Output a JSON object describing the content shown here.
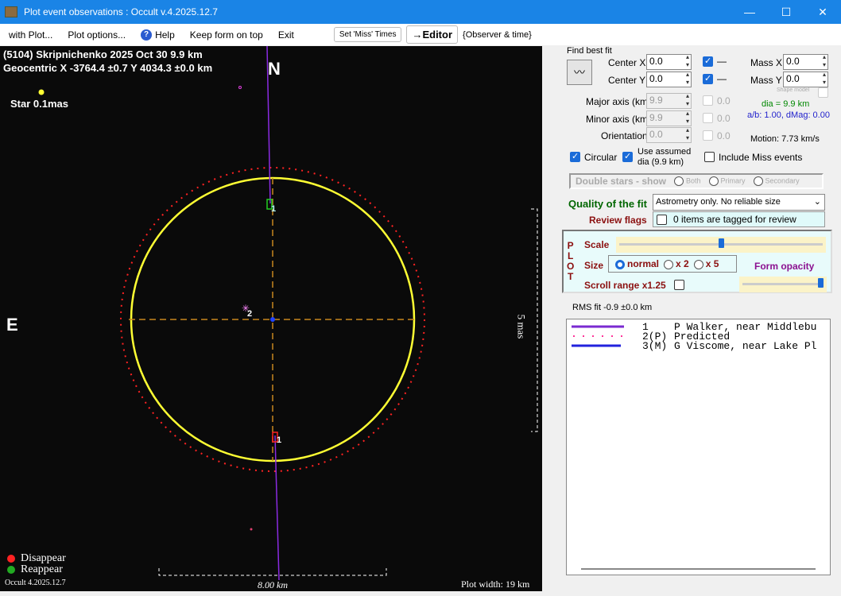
{
  "window": {
    "title": "Plot event observations : Occult v.4.2025.12.7",
    "min": "—",
    "max": "☐",
    "close": "✕"
  },
  "menu": {
    "with_plot": "with Plot...",
    "plot_options": "Plot options...",
    "help": "Help",
    "keep_on_top": "Keep form on top",
    "exit": "Exit",
    "set_miss": "Set 'Miss' Times",
    "editor": "→Editor",
    "observer_time": "{Observer & time}"
  },
  "plot": {
    "header1": "(5104) Skripnichenko  2025 Oct 30  9.9 km",
    "header2": "Geocentric  X  -3764.4 ±0.7  Y 4034.3 ±0.0 km",
    "north": "N",
    "east": "E",
    "star": "Star 0.1mas",
    "chord1_label": "1",
    "chord1_label_b": "1",
    "point2_label": "2",
    "scale_mas": "5 mas",
    "disappear": "Disappear",
    "reappear": "Reappear",
    "version": "Occult 4.2025.12.7",
    "scale_km": "8.00 km",
    "plot_width": "Plot width: 19 km",
    "colors": {
      "ellipse": "#ffff33",
      "predicted": "#ff2222",
      "chord": "#8a2be2",
      "axes": "#c8861e"
    }
  },
  "fit": {
    "title": "Find best fit",
    "center_x_label": "Center X",
    "center_x": "0.0",
    "center_y_label": "Center Y",
    "center_y": "0.0",
    "cx_dash": "—",
    "cy_dash": "—",
    "mass_x_label": "Mass X",
    "mass_x": "0.0",
    "mass_y_label": "Mass Y",
    "mass_y": "0.0",
    "shape_model": "Shape model",
    "major_label": "Major axis (km)",
    "major": "9.9",
    "major_v": "0.0",
    "minor_label": "Minor axis (km)",
    "minor": "9.9",
    "minor_v": "0.0",
    "orient_label": "Orientation",
    "orient": "0.0",
    "orient_v": "0.0",
    "dia": "dia = 9.9 km",
    "ab": "a/b: 1.00, dMag: 0.00",
    "motion": "Motion: 7.73 km/s",
    "circular": "Circular",
    "use_assumed": "Use assumed",
    "use_assumed2": "dia (9.9 km)",
    "include_miss": "Include Miss events",
    "double_stars": "Double stars - show",
    "both": "Both",
    "primary": "Primary",
    "secondary": "Secondary",
    "quality_label": "Quality of the fit",
    "quality_value": "Astrometry only. No reliable size",
    "review_label": "Review flags",
    "review_value": "0 items are tagged for review"
  },
  "plotopts": {
    "letters": [
      "P",
      "L",
      "O",
      "T"
    ],
    "scale": "Scale",
    "scale_value": 0.5,
    "size": "Size",
    "normal": "normal",
    "x2": "x 2",
    "x5": "x 5",
    "form_opacity": "Form opacity",
    "opacity_value": 1.0,
    "scroll_range": "Scroll range x1.25"
  },
  "rms": "RMS fit -0.9 ±0.0 km",
  "legend": [
    {
      "num": "1",
      "name": "P Walker, near Middlebu"
    },
    {
      "num": "2(P)",
      "name": "Predicted"
    },
    {
      "num": "3(M)",
      "name": "G Viscome, near Lake Pl"
    }
  ]
}
